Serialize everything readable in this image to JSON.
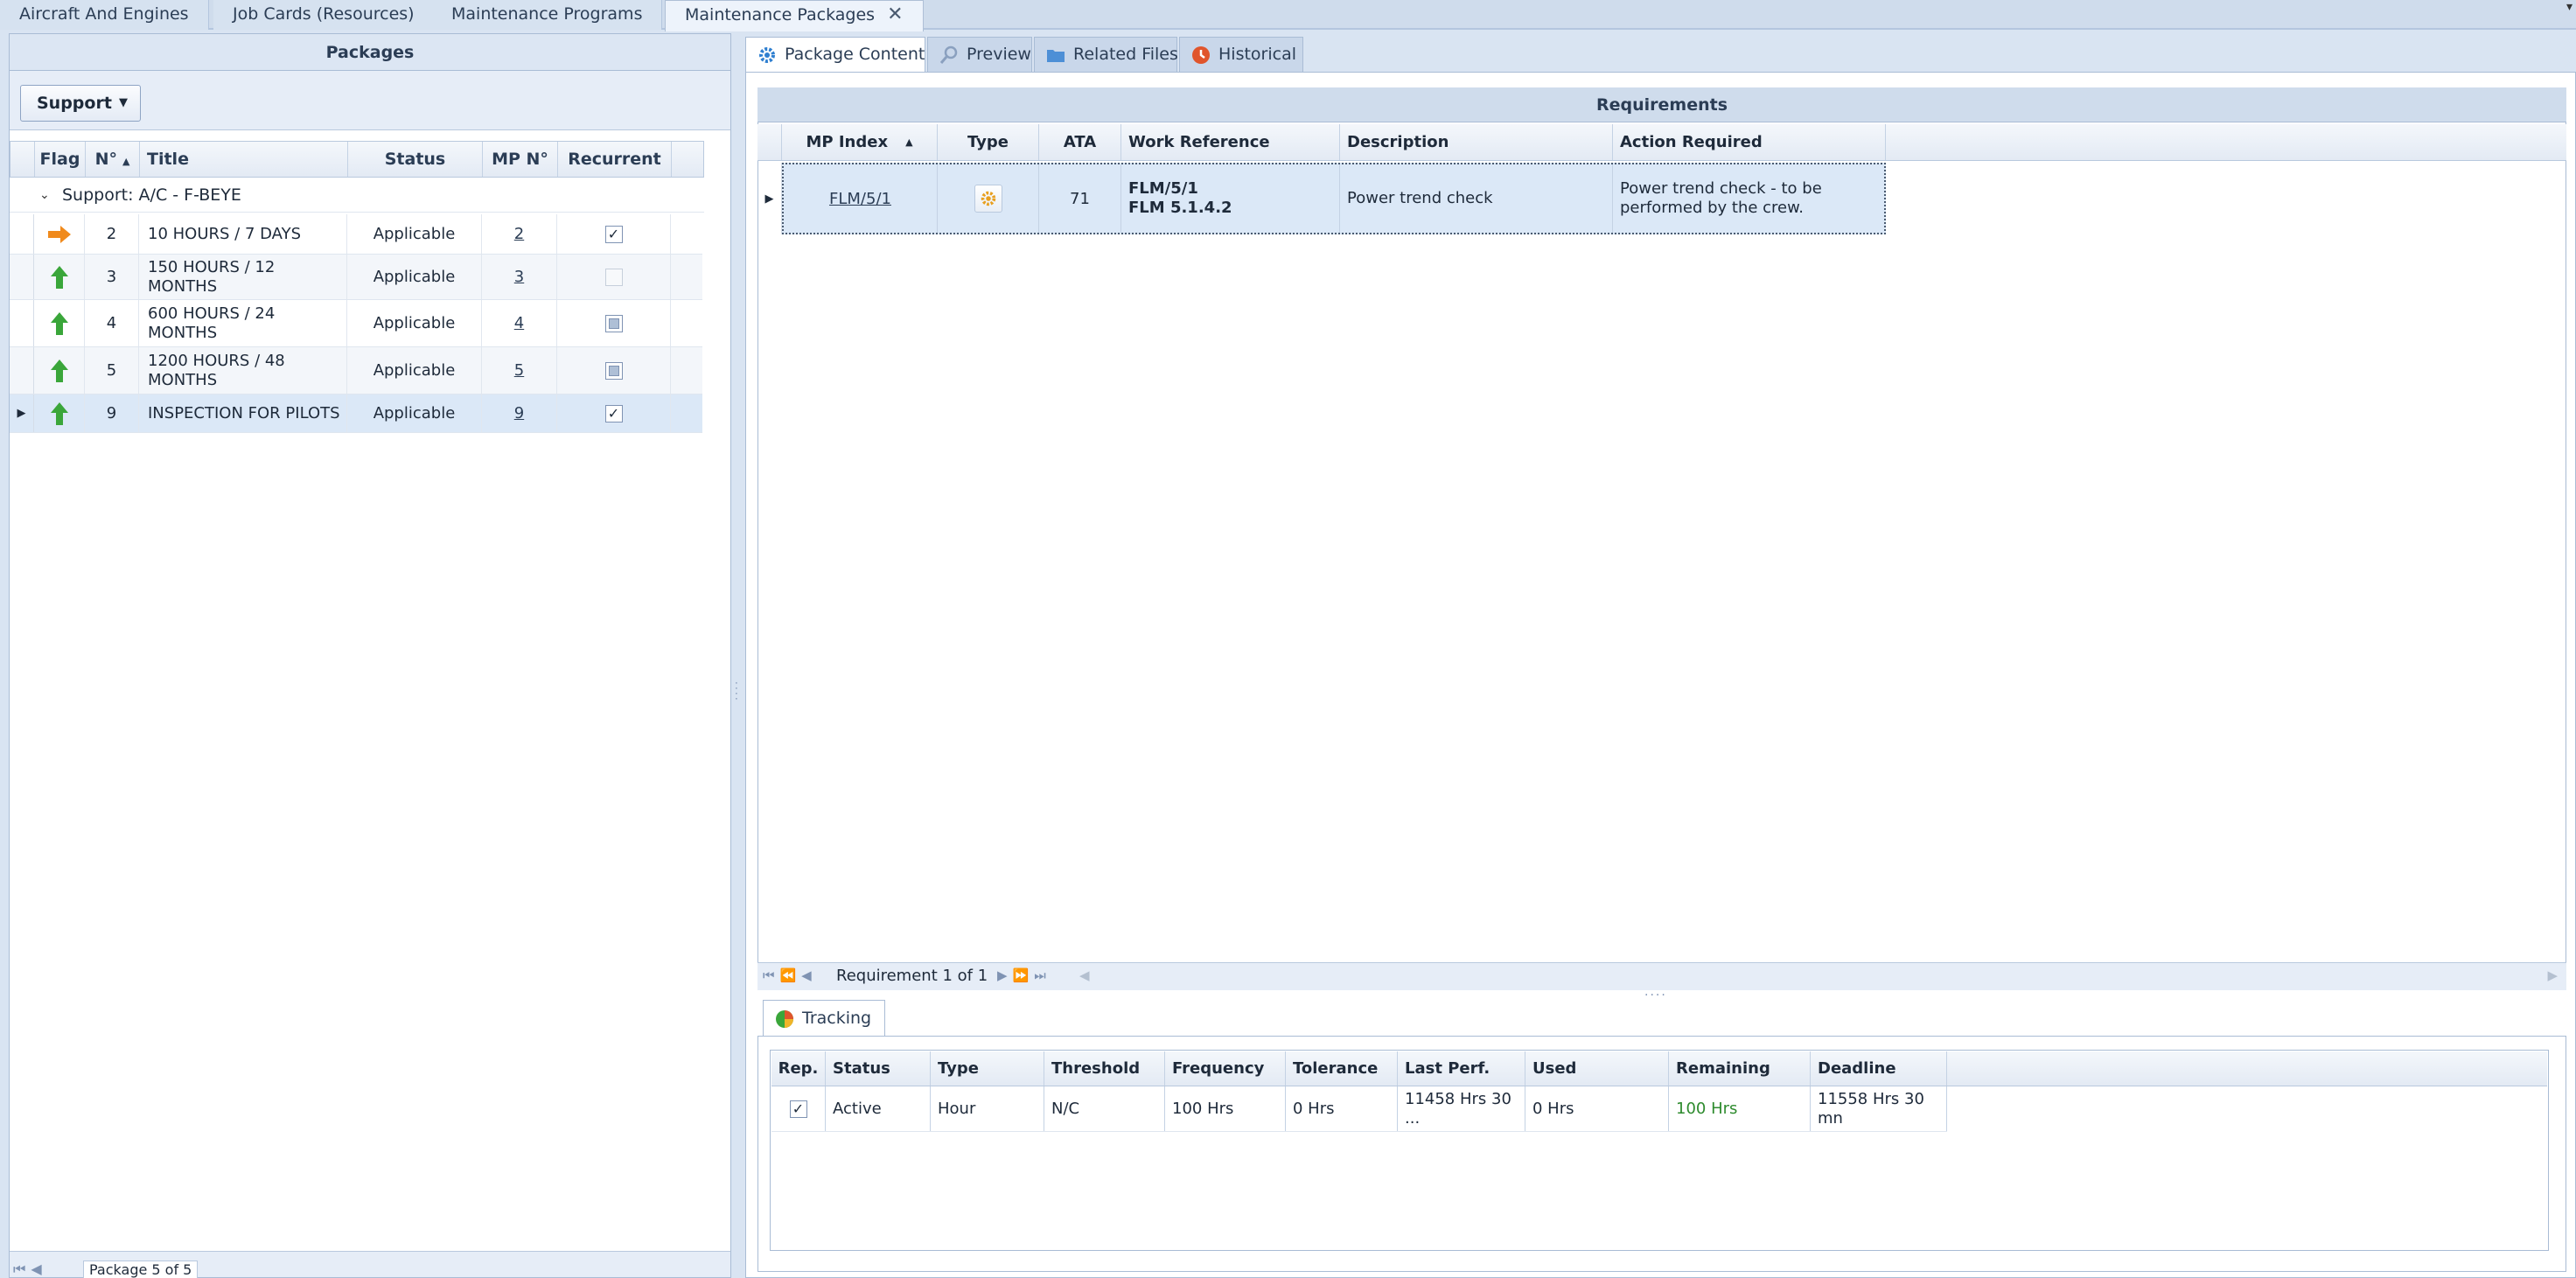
{
  "doc_tabs": [
    "Aircraft And Engines",
    "Job Cards (Resources)",
    "Maintenance Programs",
    "Maintenance Packages"
  ],
  "left_panel": {
    "title": "Packages",
    "support_button": "Support",
    "columns": [
      "Flag",
      "N°",
      "Title",
      "Status",
      "MP N°",
      "Recurrent"
    ],
    "group_label": "Support: A/C - F-BEYE",
    "rows": [
      {
        "flag": "arrow-right-orange",
        "no": "2",
        "title": "10 HOURS / 7 DAYS",
        "status": "Applicable",
        "mp": "2",
        "recurrent": "checked"
      },
      {
        "flag": "arrow-up-green",
        "no": "3",
        "title": "150 HOURS / 12 MONTHS",
        "status": "Applicable",
        "mp": "3",
        "recurrent": "disabled"
      },
      {
        "flag": "arrow-up-green",
        "no": "4",
        "title": "600 HOURS / 24 MONTHS",
        "status": "Applicable",
        "mp": "4",
        "recurrent": "indeterminate"
      },
      {
        "flag": "arrow-up-green",
        "no": "5",
        "title": "1200 HOURS / 48 MONTHS",
        "status": "Applicable",
        "mp": "5",
        "recurrent": "indeterminate"
      },
      {
        "flag": "arrow-up-green",
        "no": "9",
        "title": "INSPECTION FOR PILOTS",
        "status": "Applicable",
        "mp": "9",
        "recurrent": "checked"
      }
    ],
    "pager": "Package 5 of 5"
  },
  "right_tabs": [
    "Package Content",
    "Preview",
    "Related Files",
    "Historical"
  ],
  "requirements": {
    "title": "Requirements",
    "columns": [
      "MP Index",
      "Type",
      "ATA",
      "Work Reference",
      "Description",
      "Action Required"
    ],
    "row": {
      "mp_index": "FLM/5/1",
      "type_icon": "gear-icon",
      "ata": "71",
      "work_ref_line1": "FLM/5/1",
      "work_ref_line2": "FLM 5.1.4.2",
      "description": "Power trend check",
      "action_line1": "Power trend check - to be",
      "action_line2": "performed by the crew."
    },
    "pager": "Requirement 1 of 1"
  },
  "tracking": {
    "tab": "Tracking",
    "columns": [
      "Rep.",
      "Status",
      "Type",
      "Threshold",
      "Frequency",
      "Tolerance",
      "Last Perf.",
      "Used",
      "Remaining",
      "Deadline"
    ],
    "row": {
      "rep": "checked",
      "status": "Active",
      "type": "Hour",
      "threshold": "N/C",
      "frequency": "100 Hrs",
      "tolerance": "0 Hrs",
      "last_perf": "11458 Hrs 30 ...",
      "used": "0 Hrs",
      "remaining": "100 Hrs",
      "deadline_line1": "11558 Hrs 30",
      "deadline_line2": "mn"
    }
  },
  "colors": {
    "accent": "#dbe8f7",
    "remaining_green": "#2e8b2e",
    "flag_orange": "#f08a1c",
    "flag_green": "#3aa63a"
  }
}
